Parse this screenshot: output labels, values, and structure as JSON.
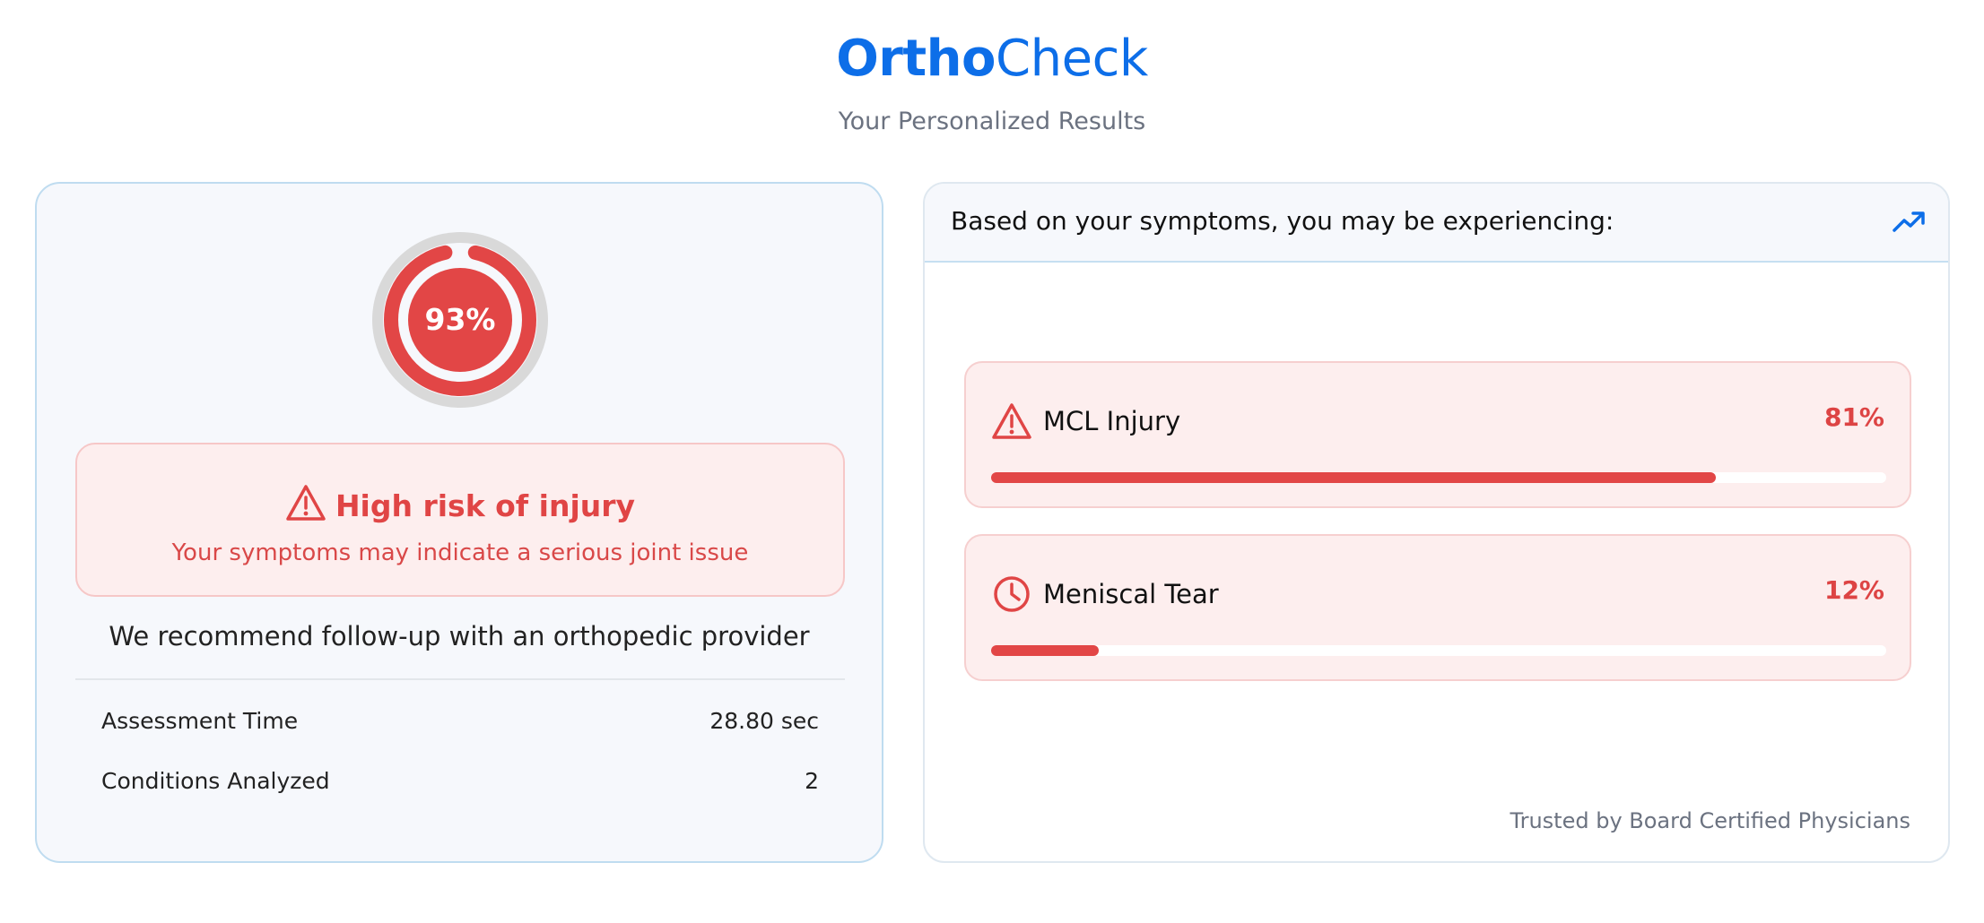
{
  "header": {
    "brand_bold": "Ortho",
    "brand_light": "Check",
    "subtitle": "Your Personalized Results"
  },
  "summary": {
    "score_label": "93%",
    "score_fraction": 0.93,
    "risk_title": "High risk of injury",
    "risk_subtitle": "Your symptoms may indicate a serious joint issue",
    "recommendation": "We recommend follow-up with an orthopedic provider",
    "stats": [
      {
        "label": "Assessment Time",
        "value": "28.80 sec"
      },
      {
        "label": "Conditions Analyzed",
        "value": "2"
      }
    ]
  },
  "conditions_panel": {
    "heading": "Based on your symptoms, you may be experiencing:",
    "heading_icon": "trending-up-icon",
    "conditions": [
      {
        "name": "MCL Injury",
        "percent_label": "81%",
        "percent": 81,
        "icon": "warning-icon"
      },
      {
        "name": "Meniscal Tear",
        "percent_label": "12%",
        "percent": 12,
        "icon": "clock-icon"
      }
    ],
    "footer": "Trusted by Board Certified Physicians"
  },
  "colors": {
    "brand": "#0d6ee8",
    "danger": "#e24646",
    "danger_bg": "#fdeeee"
  }
}
